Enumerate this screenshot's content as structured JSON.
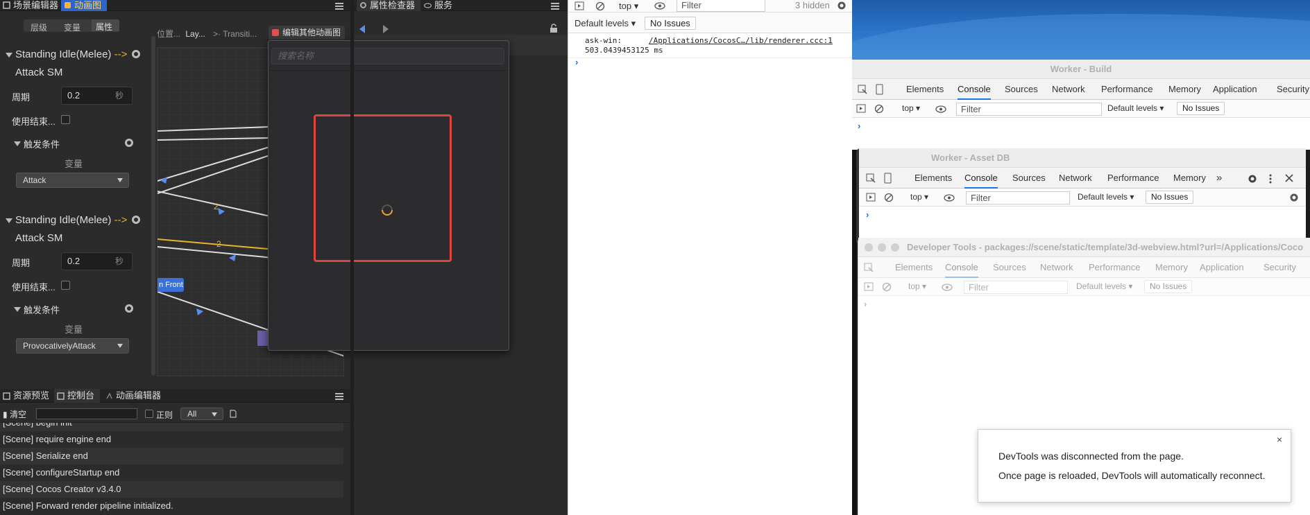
{
  "cocos": {
    "tabs_top_left": [
      "场景编辑器",
      "动画图"
    ],
    "tabs_top_right": [
      "属性检查器",
      "服务"
    ],
    "subtabs": [
      "层级",
      "变量",
      "属性"
    ],
    "breadcrumb": {
      "a": "位置...",
      "b": "Lay...",
      "c": ">· Transiti..."
    },
    "edit_other_button": "编辑其他动画图",
    "search_placeholder": "搜索名称",
    "transitions": [
      {
        "title": "Standing Idle(Melee)",
        "arrow": "-->",
        "target": "Attack SM",
        "period_label": "周期",
        "period_value": "0.2",
        "period_unit": "秒",
        "use_end_label": "使用结束...",
        "conditions_label": "触发条件",
        "var_label": "变量",
        "var_value": "Attack"
      },
      {
        "title": "Standing Idle(Melee)",
        "arrow": "-->",
        "target": "Attack SM",
        "period_label": "周期",
        "period_value": "0.2",
        "period_unit": "秒",
        "use_end_label": "使用结束...",
        "conditions_label": "触发条件",
        "var_label": "变量",
        "var_value": "ProvocativelyAttack"
      }
    ],
    "graph": {
      "node_label": "n Front",
      "count_labels": [
        "2",
        "2"
      ]
    },
    "bottom_tabs": [
      "资源预览",
      "控制台",
      "动画编辑器"
    ],
    "console_toolbar": {
      "clear": "清空",
      "regex": "正则",
      "level": "All"
    },
    "log": [
      "[Scene] begin init",
      "[Scene] require engine end",
      "[Scene] Serialize end",
      "[Scene] configureStartup end",
      "[Scene] Cocos Creator v3.4.0",
      "[Scene] Forward render pipeline initialized."
    ]
  },
  "main_console": {
    "context": "top",
    "filter_placeholder": "Filter",
    "hidden_count": "3 hidden",
    "default_levels": "Default levels",
    "no_issues": "No Issues",
    "log_source": "ask-win:",
    "log_link": "/Applications/CocosC…/lib/renderer.ccc:1",
    "log_value": "503.0439453125 ms"
  },
  "worker_build": {
    "title": "Worker - Build",
    "tabs": [
      "Elements",
      "Console",
      "Sources",
      "Network",
      "Performance",
      "Memory",
      "Application",
      "Security"
    ],
    "active_tab": "Console",
    "context": "top",
    "filter_placeholder": "Filter",
    "default_levels": "Default levels",
    "no_issues": "No Issues"
  },
  "worker_asset": {
    "title": "Worker - Asset DB",
    "tabs": [
      "Elements",
      "Console",
      "Sources",
      "Network",
      "Performance",
      "Memory"
    ],
    "more": "»",
    "active_tab": "Console",
    "context": "top",
    "filter_placeholder": "Filter",
    "default_levels": "Default levels",
    "no_issues": "No Issues"
  },
  "devtools_webview": {
    "title": "Developer Tools - packages://scene/static/template/3d-webview.html?url=/Applications/Coco",
    "tabs": [
      "Elements",
      "Console",
      "Sources",
      "Network",
      "Performance",
      "Memory",
      "Application",
      "Security"
    ],
    "active_tab": "Console",
    "context": "top",
    "filter_placeholder": "Filter",
    "default_levels": "Default levels",
    "no_issues": "No Issues",
    "disconnect_line1": "DevTools was disconnected from the page.",
    "disconnect_line2": "Once page is reloaded, DevTools will automatically reconnect.",
    "close": "×"
  },
  "colors": {
    "accent_blue": "#1a73e8",
    "cocos_blue": "#2f64c8",
    "highlight_red": "#e0443e",
    "transition_yellow": "#e8b52a"
  }
}
